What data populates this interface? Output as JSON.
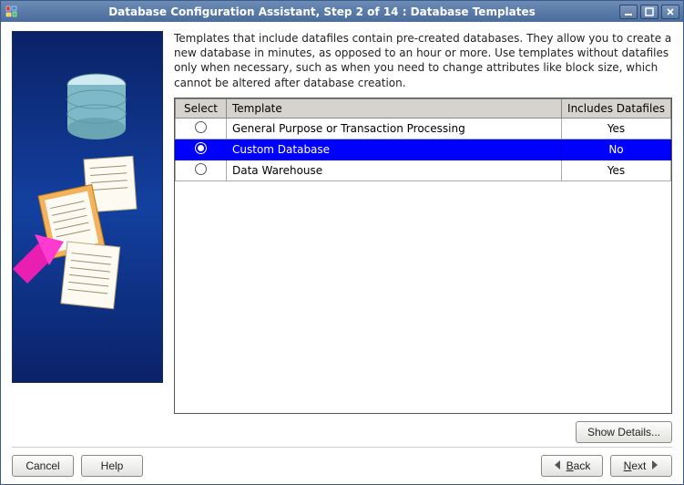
{
  "window": {
    "title": "Database Configuration Assistant, Step 2 of 14 : Database Templates"
  },
  "instruction": "Templates that include datafiles contain pre-created databases. They allow you to create a new database in minutes, as opposed to an hour or more. Use templates without datafiles only when necessary, such as when you need to change attributes like block size, which cannot be altered after database creation.",
  "table": {
    "headers": {
      "select": "Select",
      "template": "Template",
      "includes": "Includes Datafiles"
    },
    "rows": [
      {
        "template": "General Purpose or Transaction Processing",
        "includes": "Yes",
        "selected": false
      },
      {
        "template": "Custom Database",
        "includes": "No",
        "selected": true
      },
      {
        "template": "Data Warehouse",
        "includes": "Yes",
        "selected": false
      }
    ]
  },
  "buttons": {
    "show_details": "Show Details...",
    "cancel": "Cancel",
    "help": "Help",
    "back": "Back",
    "next": "Next"
  }
}
